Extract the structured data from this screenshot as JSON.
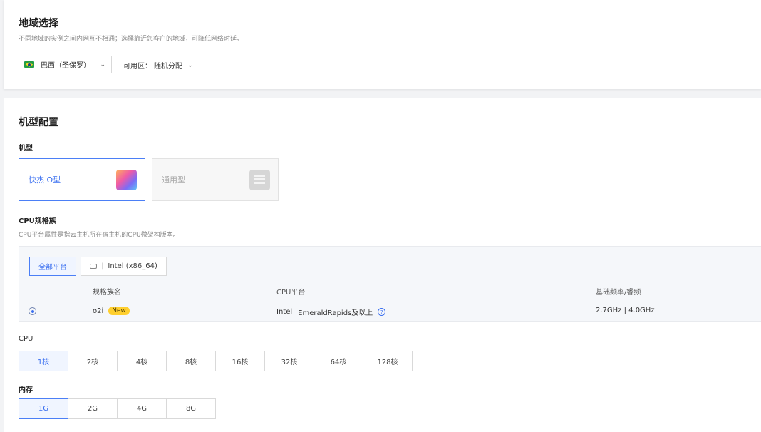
{
  "region": {
    "title": "地域选择",
    "description": "不同地域的实例之间内网互不相通；选择靠近您客户的地域，可降低网络时延。",
    "selected_region": "巴西（圣保罗）",
    "az_label": "可用区：",
    "az_value": "随机分配"
  },
  "spec": {
    "title": "机型配置",
    "type_label": "机型",
    "types": [
      {
        "label": "快杰 O型",
        "selected": true
      },
      {
        "label": "通用型",
        "selected": false
      }
    ],
    "cpu_family_label": "CPU规格族",
    "cpu_family_desc": "CPU平台属性是指云主机所在宿主机的CPU微架构版本。",
    "platforms": [
      "全部平台",
      "Intel (x86_64)"
    ],
    "columns": [
      "规格族名",
      "CPU平台",
      "基础频率/睿频"
    ],
    "family_rows": [
      {
        "name": "o2i",
        "badge": "New",
        "platform_vendor": "Intel",
        "platform_model": "EmeraldRapids及以上",
        "freq": "2.7GHz | 4.0GHz"
      }
    ],
    "cpu_label": "CPU",
    "cpu_options": [
      "1核",
      "2核",
      "4核",
      "8核",
      "16核",
      "32核",
      "64核",
      "128核"
    ],
    "mem_label": "内存",
    "mem_options": [
      "1G",
      "2G",
      "4G",
      "8G"
    ]
  },
  "colors": {
    "accent": "#3a6ff0",
    "badge": "#ffcf2e"
  }
}
